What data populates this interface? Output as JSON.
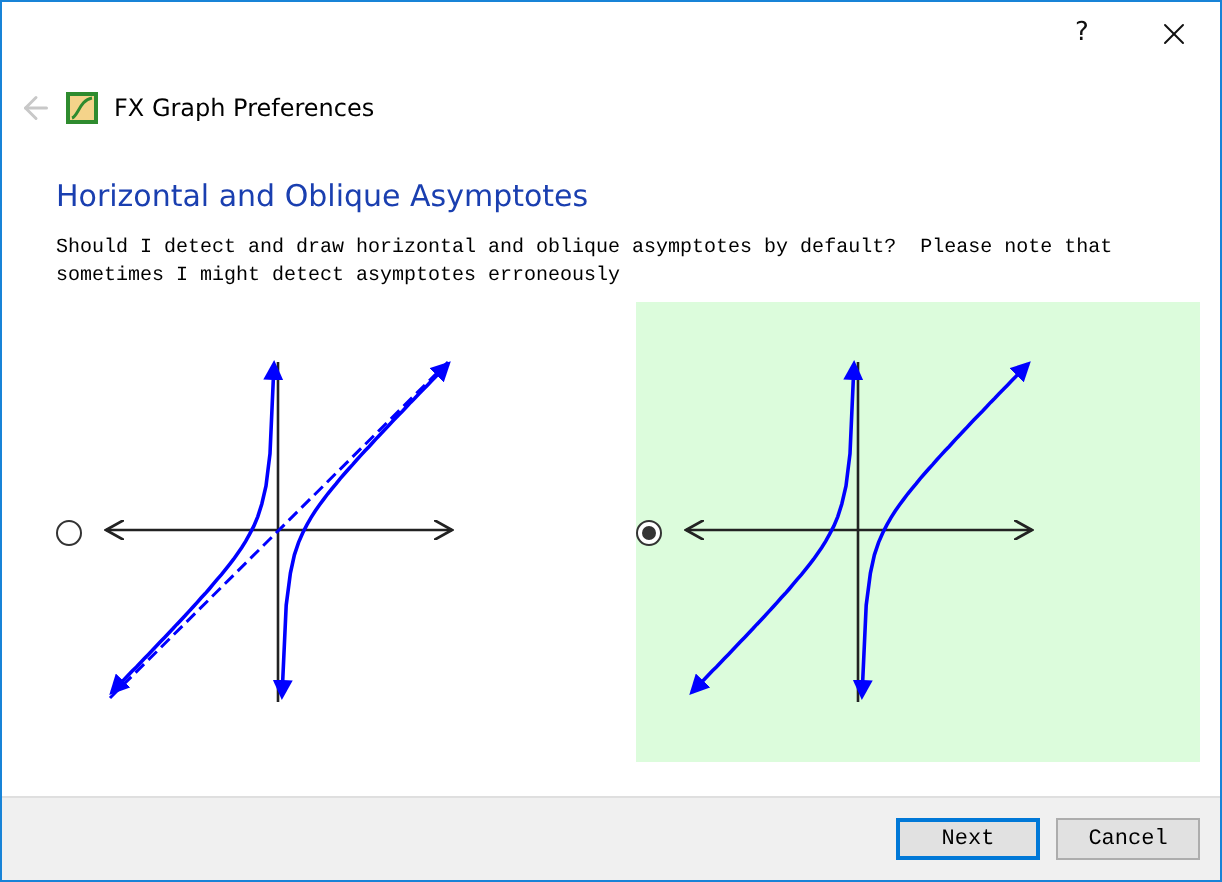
{
  "window": {
    "title": "FX Graph Preferences",
    "help": "?"
  },
  "heading": "Horizontal and Oblique Asymptotes",
  "description": "Should I detect and draw horizontal and oblique asymptotes by default?  Please note that sometimes I might detect asymptotes erroneously",
  "options": [
    {
      "selected": false,
      "show_asymptote": true
    },
    {
      "selected": true,
      "show_asymptote": false
    }
  ],
  "buttons": [
    {
      "label": "Next",
      "default": true
    },
    {
      "label": "Cancel",
      "default": false
    }
  ]
}
